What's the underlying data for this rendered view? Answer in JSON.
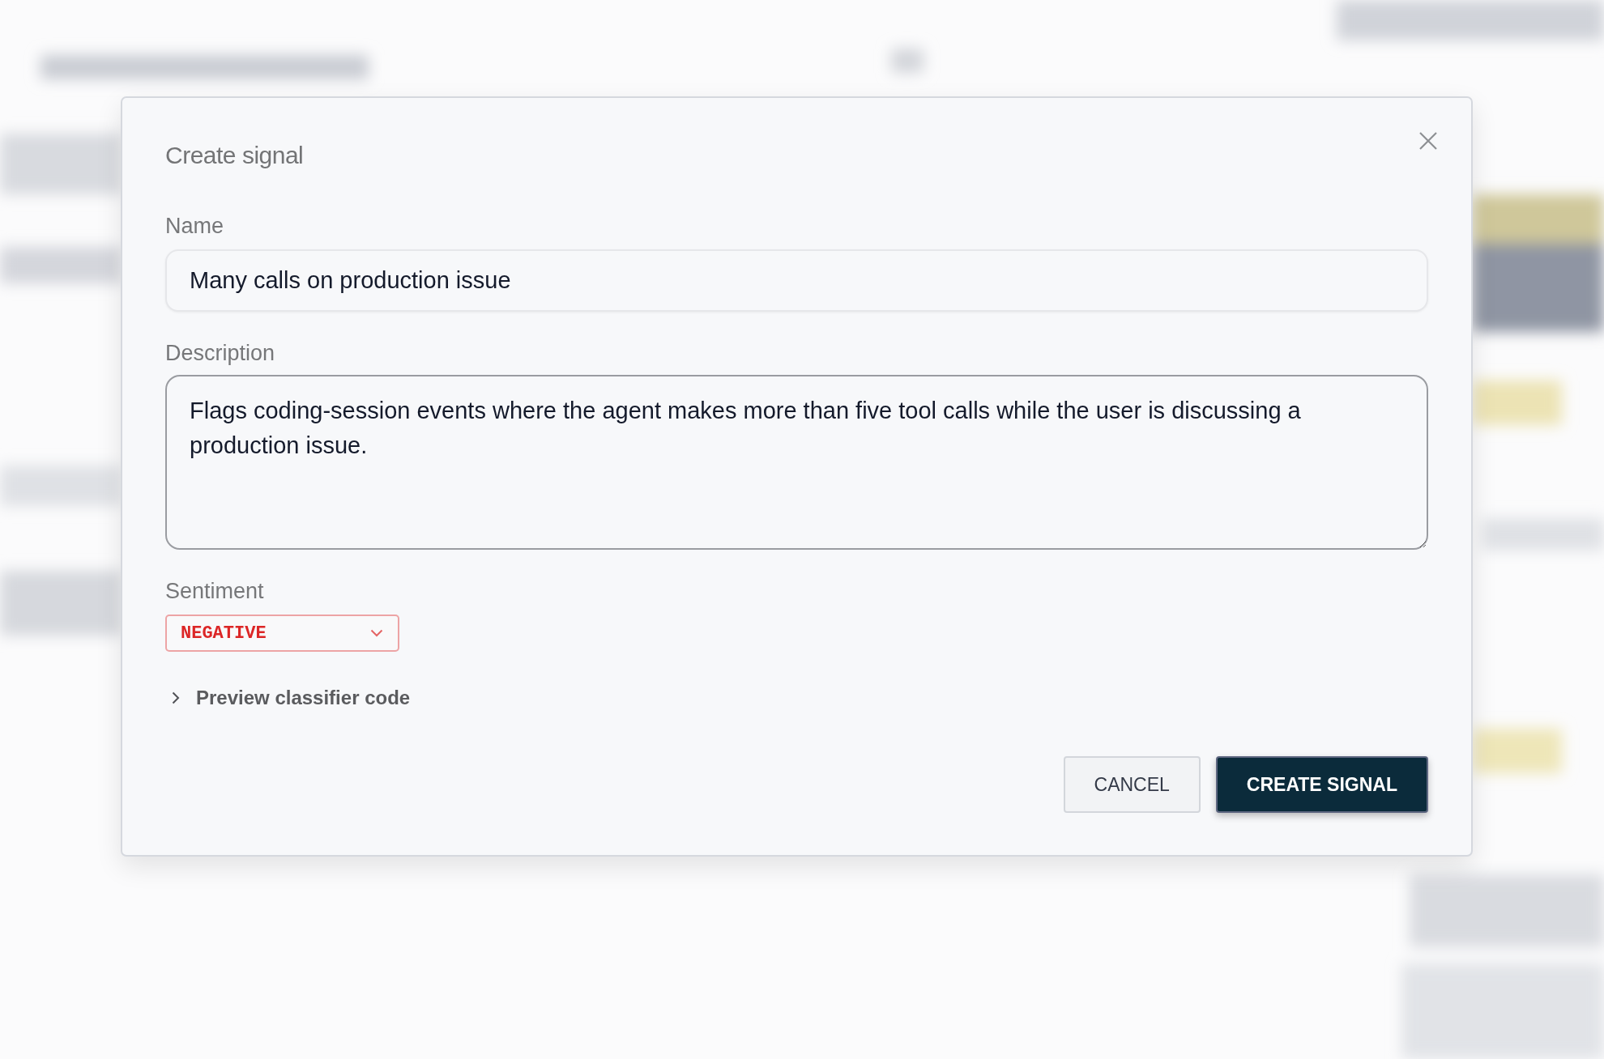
{
  "dialog": {
    "title": "Create signal",
    "fields": [
      {
        "kind": "text",
        "label": "Name",
        "value": "Many calls on production issue",
        "focused": false
      },
      {
        "kind": "textarea",
        "label": "Description",
        "value": "Flags coding-session events where the agent makes more than five tool calls while the user is discussing a production issue.",
        "focused": true
      },
      {
        "kind": "select",
        "label": "Sentiment",
        "value": "NEGATIVE",
        "color": "#dc2626"
      }
    ],
    "disclosure": {
      "label": "Preview classifier code",
      "expanded": false
    },
    "buttons": [
      {
        "kind": "secondary",
        "label": "CANCEL"
      },
      {
        "kind": "primary",
        "label": "CREATE SIGNAL"
      }
    ]
  }
}
